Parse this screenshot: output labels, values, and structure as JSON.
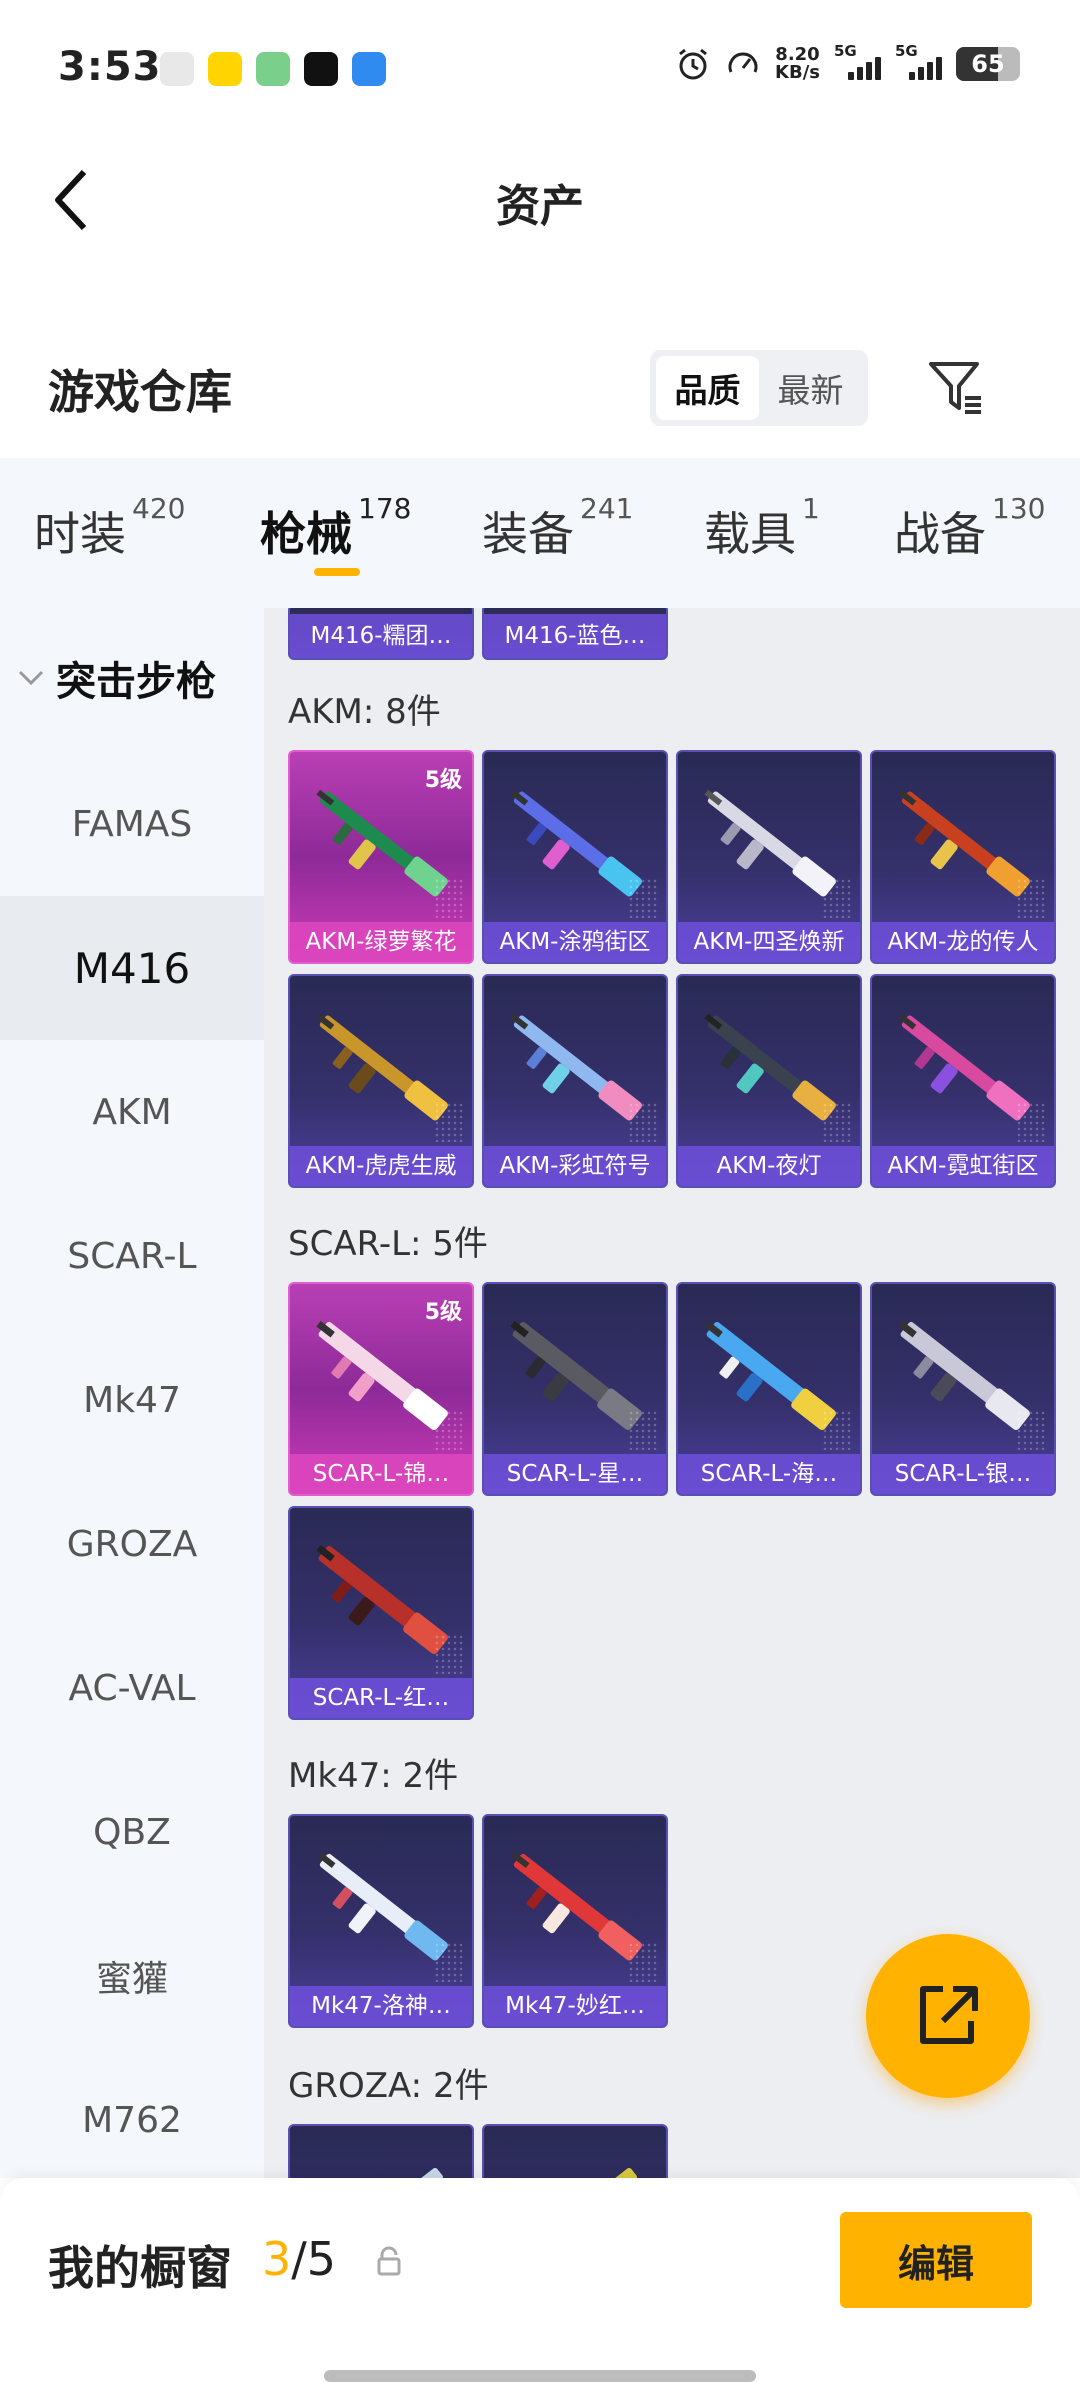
{
  "status_bar": {
    "time": "3:53",
    "net_speed_value": "8.20",
    "net_speed_unit": "KB/s",
    "sim1_tag": "5G",
    "sim2_tag": "5G",
    "battery": "65"
  },
  "header": {
    "title": "资产"
  },
  "warehouse": {
    "title": "游戏仓库",
    "sort_options": [
      "品质",
      "最新"
    ],
    "sort_selected": "品质"
  },
  "tabs": [
    {
      "label": "时装",
      "count": "420"
    },
    {
      "label": "枪械",
      "count": "178",
      "active": true
    },
    {
      "label": "装备",
      "count": "241"
    },
    {
      "label": "载具",
      "count": "1"
    },
    {
      "label": "战备",
      "count": "130"
    }
  ],
  "sidebar": {
    "group": "突击步枪",
    "items": [
      "FAMAS",
      "M416",
      "AKM",
      "SCAR-L",
      "Mk47",
      "GROZA",
      "AC-VAL",
      "QBZ",
      "蜜獾",
      "M762"
    ],
    "active": "M416"
  },
  "content": {
    "partial_top": [
      "M416-糯团…",
      "M416-蓝色…"
    ],
    "sections": [
      {
        "title": "AKM: 8件",
        "items": [
          {
            "name": "AKM-绿萝繁花",
            "level": "5级",
            "rarity": "legendary"
          },
          {
            "name": "AKM-涂鸦街区",
            "rarity": "epic"
          },
          {
            "name": "AKM-四圣焕新",
            "rarity": "epic"
          },
          {
            "name": "AKM-龙的传人",
            "rarity": "epic"
          },
          {
            "name": "AKM-虎虎生威",
            "rarity": "epic"
          },
          {
            "name": "AKM-彩虹符号",
            "rarity": "epic"
          },
          {
            "name": "AKM-夜灯",
            "rarity": "epic"
          },
          {
            "name": "AKM-霓虹街区",
            "rarity": "epic"
          }
        ]
      },
      {
        "title": "SCAR-L: 5件",
        "items": [
          {
            "name": "SCAR-L-锦…",
            "level": "5级",
            "rarity": "legendary"
          },
          {
            "name": "SCAR-L-星…",
            "rarity": "epic"
          },
          {
            "name": "SCAR-L-海…",
            "rarity": "epic"
          },
          {
            "name": "SCAR-L-银…",
            "rarity": "epic"
          },
          {
            "name": "SCAR-L-红…",
            "rarity": "epic"
          }
        ]
      },
      {
        "title": "Mk47: 2件",
        "items": [
          {
            "name": "Mk47-洛神…",
            "rarity": "epic"
          },
          {
            "name": "Mk47-妙红…",
            "rarity": "epic"
          }
        ]
      },
      {
        "title": "GROZA: 2件",
        "items": []
      }
    ]
  },
  "showcase": {
    "label": "我的橱窗",
    "current": "3",
    "separator": "/",
    "total": "5",
    "edit_label": "编辑"
  },
  "colors": {
    "accent": "#ffb300",
    "card_epic": "#34306a",
    "card_legendary": "#b93fb5"
  }
}
